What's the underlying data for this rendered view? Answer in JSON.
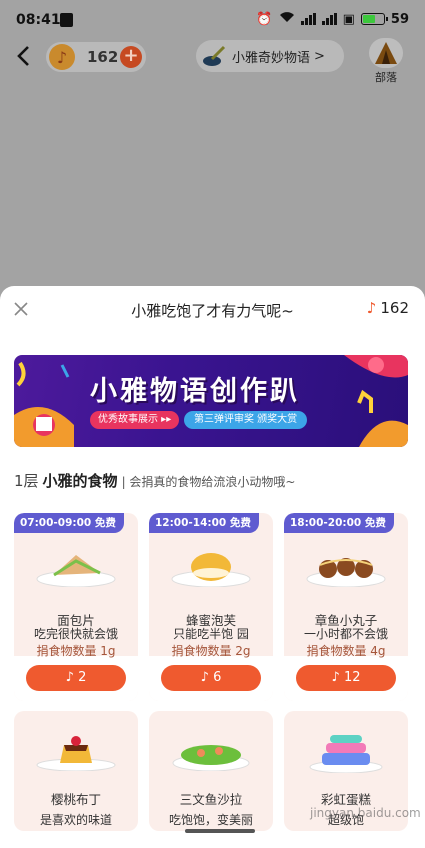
{
  "status_bar": {
    "time": "08:41",
    "battery": "59"
  },
  "top_bar": {
    "coins": "162",
    "story_label": "小雅奇妙物语",
    "story_chevron": ">",
    "tribe_label": "部落"
  },
  "sheet": {
    "title": "小雅吃饱了才有力气呢~",
    "coins": "162"
  },
  "banner": {
    "title": "小雅物语创作趴",
    "tag1": "优秀故事展示 ▸▸",
    "tag2": "第三弹评审奖 颁奖大赏"
  },
  "section": {
    "level": "1层",
    "title": "小雅的食物",
    "subtitle": "| 会捐真的食物给流浪小动物哦~"
  },
  "foods": [
    {
      "time": "07:00-09:00 免费",
      "name": "面包片",
      "desc": "吃完很快就会饿",
      "qty": "捐食物数量 1g",
      "cost": "2",
      "icon": "sandwich-icon"
    },
    {
      "time": "12:00-14:00 免费",
      "name": "蜂蜜泡芙",
      "desc": "只能吃半饱 园",
      "qty": "捐食物数量 2g",
      "cost": "6",
      "icon": "puff-icon"
    },
    {
      "time": "18:00-20:00 免费",
      "name": "章鱼小丸子",
      "desc": "一小时都不会饿",
      "qty": "捐食物数量 4g",
      "cost": "12",
      "icon": "takoyaki-icon"
    },
    {
      "time": "",
      "name": "樱桃布丁",
      "desc": "是喜欢的味道",
      "qty": "",
      "cost": "",
      "icon": "pudding-icon"
    },
    {
      "time": "",
      "name": "三文鱼沙拉",
      "desc": "吃饱饱，变美丽",
      "qty": "",
      "cost": "",
      "icon": "salad-icon"
    },
    {
      "time": "",
      "name": "彩虹蛋糕",
      "desc": "超级饱",
      "qty": "",
      "cost": "",
      "icon": "cake-icon"
    }
  ],
  "watermark": "jingyan.baidu.com",
  "colors": {
    "accent": "#ef5a2f",
    "time_badge": "#5f5bd0",
    "card_bg": "#fbeeea",
    "overlay": "#a3a3a3"
  }
}
